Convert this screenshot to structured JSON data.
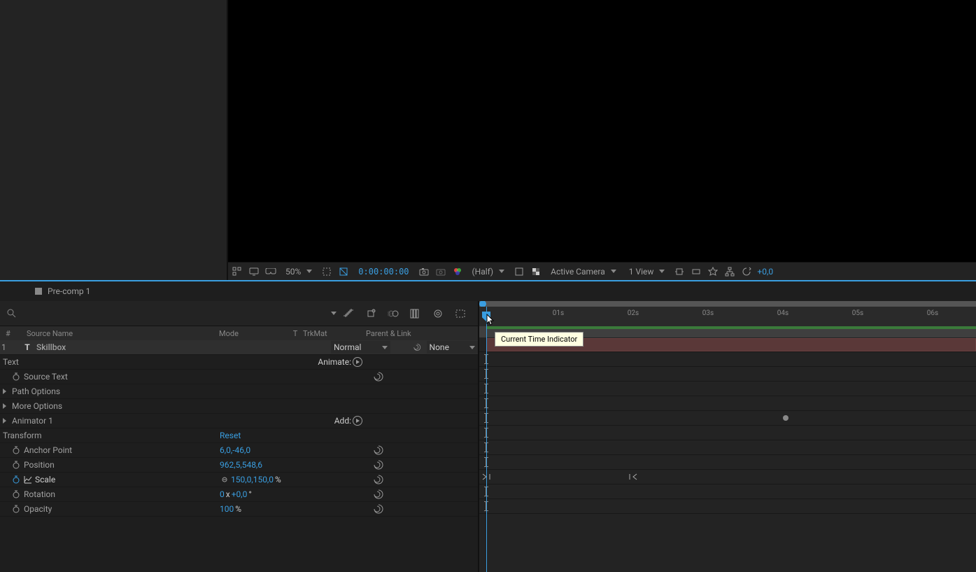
{
  "viewer": {
    "zoom": "50%",
    "timecode": "0:00:00:00",
    "resolution": "(Half)",
    "camera": "Active Camera",
    "views": "1 View",
    "offset": "+0,0"
  },
  "timeline": {
    "tab_name": "Pre-comp 1",
    "columns": {
      "num": "#",
      "source": "Source Name",
      "mode": "Mode",
      "t": "T",
      "trkmat": "TrkMat",
      "parent": "Parent & Link"
    },
    "layer": {
      "num": "1",
      "name": "Skillbox",
      "mode": "Normal",
      "trkmat": "None"
    },
    "groups": {
      "text": "Text",
      "animate": "Animate:",
      "source_text": "Source Text",
      "path_options": "Path Options",
      "more_options": "More Options",
      "animator": "Animator 1",
      "add": "Add:",
      "transform": "Transform",
      "reset": "Reset"
    },
    "props": {
      "anchor_point": {
        "label": "Anchor Point",
        "value": "6,0,-46,0"
      },
      "position": {
        "label": "Position",
        "value": "962,5,548,6"
      },
      "scale": {
        "label": "Scale",
        "value": "150,0,150,0",
        "unit": "%"
      },
      "rotation": {
        "label": "Rotation",
        "prefix": "0",
        "x": "x",
        "value": "+0,0",
        "unit": "°"
      },
      "opacity": {
        "label": "Opacity",
        "value": "100",
        "unit": "%"
      }
    },
    "ruler": [
      "01s",
      "02s",
      "03s",
      "04s",
      "05s",
      "06s"
    ],
    "tooltip": "Current Time Indicator"
  }
}
